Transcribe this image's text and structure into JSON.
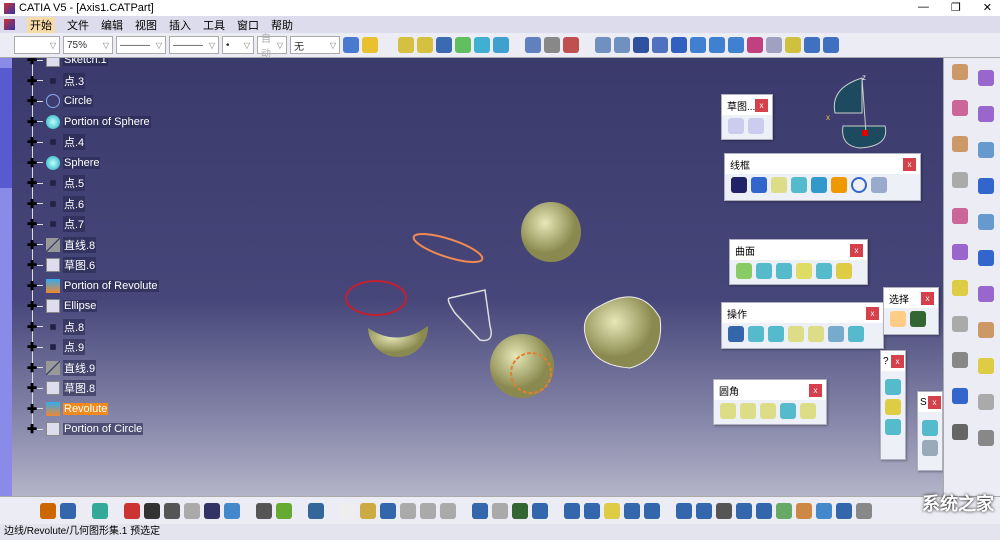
{
  "window": {
    "title": "CATIA V5 - [Axis1.CATPart]",
    "controls": [
      "—",
      "❐",
      "✕"
    ]
  },
  "menu": [
    "开始",
    "文件",
    "编辑",
    "视图",
    "插入",
    "工具",
    "窗口",
    "帮助"
  ],
  "toolbar1": {
    "color": "",
    "transparency": "75%",
    "linetype": "———",
    "thickness": "———",
    "point": "•",
    "layer_label": "自动",
    "layer": "无"
  },
  "tree": [
    {
      "label": "Sketch.1",
      "icon": "sketch-icon"
    },
    {
      "label": "点.3",
      "icon": "point-icon"
    },
    {
      "label": "Circle",
      "icon": "circle-icon"
    },
    {
      "label": "Portion of Sphere",
      "icon": "sphere-icon"
    },
    {
      "label": "点.4",
      "icon": "point-icon"
    },
    {
      "label": "Sphere",
      "icon": "sphere-icon"
    },
    {
      "label": "点.5",
      "icon": "point-icon"
    },
    {
      "label": "点.6",
      "icon": "point-icon"
    },
    {
      "label": "点.7",
      "icon": "point-icon"
    },
    {
      "label": "直线.8",
      "icon": "line-icon"
    },
    {
      "label": "草图.6",
      "icon": "sketch-icon"
    },
    {
      "label": "Portion of Revolute",
      "icon": "revolute-icon"
    },
    {
      "label": "Ellipse",
      "icon": "sketch-icon"
    },
    {
      "label": "点.8",
      "icon": "point-icon"
    },
    {
      "label": "点.9",
      "icon": "point-icon"
    },
    {
      "label": "直线.9",
      "icon": "line-icon"
    },
    {
      "label": "草图.8",
      "icon": "sketch-icon"
    },
    {
      "label": "Revolute",
      "icon": "revolute-icon",
      "selected": true
    },
    {
      "label": "Portion of Circle",
      "icon": "sketch-icon"
    }
  ],
  "panels": {
    "sketch": {
      "title": "草图...",
      "close": "x"
    },
    "wireframe": {
      "title": "线框",
      "close": "x"
    },
    "surface": {
      "title": "曲面",
      "close": "x"
    },
    "operation": {
      "title": "操作",
      "close": "x"
    },
    "select": {
      "title": "选择",
      "close": "x"
    },
    "fillet": {
      "title": "圆角",
      "close": "x"
    },
    "small1": {
      "title": "?",
      "close": "x"
    },
    "small2": {
      "title": "S",
      "close": "x"
    }
  },
  "compass": {
    "z": "z",
    "x": "x"
  },
  "status": "边线/Revolute/几何图形集.1 预选定",
  "watermark": "系统之家",
  "colors": {
    "viewport_top": "#3b3a6c",
    "selection": "#f08a1e",
    "close": "#d6404a",
    "surface": "#c8c890"
  }
}
